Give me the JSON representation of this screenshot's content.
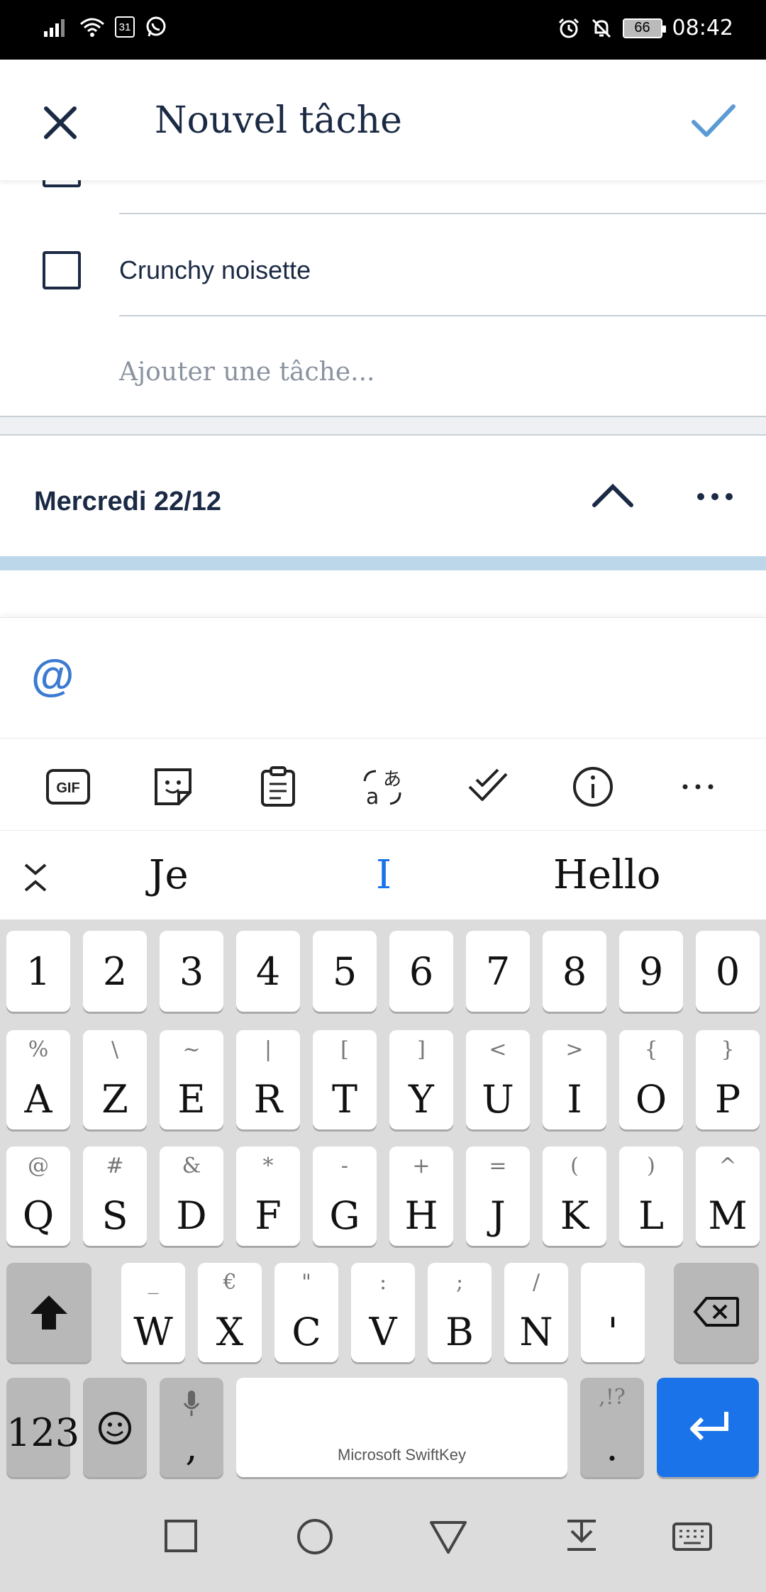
{
  "status_bar": {
    "time": "08:42",
    "battery": "66",
    "calendar_badge": "31"
  },
  "header": {
    "title": "Nouvel tâche"
  },
  "checklist": {
    "items": [
      {
        "label": "Crunchy noisette",
        "checked": false
      }
    ],
    "add_placeholder": "Ajouter une tâche..."
  },
  "day_section": {
    "label": "Mercredi 22/12"
  },
  "input_bar": {
    "symbol": "@"
  },
  "keyboard": {
    "toolbar": [
      "gif",
      "sticker",
      "clipboard",
      "translate",
      "tasks",
      "info",
      "more"
    ],
    "toolbar_gif_label": "GIF",
    "suggestions": [
      "Je",
      "I",
      "Hello"
    ],
    "rows": {
      "numbers": [
        "1",
        "2",
        "3",
        "4",
        "5",
        "6",
        "7",
        "8",
        "9",
        "0"
      ],
      "row1": [
        {
          "m": "A",
          "a": "%"
        },
        {
          "m": "Z",
          "a": "\\"
        },
        {
          "m": "E",
          "a": "~"
        },
        {
          "m": "R",
          "a": "|"
        },
        {
          "m": "T",
          "a": "["
        },
        {
          "m": "Y",
          "a": "]"
        },
        {
          "m": "U",
          "a": "<"
        },
        {
          "m": "I",
          "a": ">"
        },
        {
          "m": "O",
          "a": "{"
        },
        {
          "m": "P",
          "a": "}"
        }
      ],
      "row2": [
        {
          "m": "Q",
          "a": "@"
        },
        {
          "m": "S",
          "a": "#"
        },
        {
          "m": "D",
          "a": "&"
        },
        {
          "m": "F",
          "a": "*"
        },
        {
          "m": "G",
          "a": "-"
        },
        {
          "m": "H",
          "a": "+"
        },
        {
          "m": "J",
          "a": "="
        },
        {
          "m": "K",
          "a": "("
        },
        {
          "m": "L",
          "a": ")"
        },
        {
          "m": "M",
          "a": "^"
        }
      ],
      "row3": [
        {
          "m": "W",
          "a": "_"
        },
        {
          "m": "X",
          "a": "€"
        },
        {
          "m": "C",
          "a": "\""
        },
        {
          "m": "V",
          "a": ":"
        },
        {
          "m": "B",
          "a": ";"
        },
        {
          "m": "N",
          "a": "/"
        },
        {
          "m": "'",
          "a": ""
        }
      ]
    },
    "num_key": "123",
    "comma_key": ",",
    "period_key": ".",
    "period_alt": ",!?",
    "space_brand": "Microsoft SwiftKey"
  },
  "colors": {
    "accent_blue": "#1a73e8",
    "check_blue": "#5b9bd5",
    "text_dark": "#1b2a44"
  }
}
